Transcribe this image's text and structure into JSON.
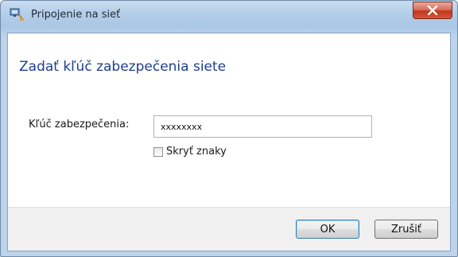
{
  "window": {
    "title": "Pripojenie na sieť",
    "close_glyph": "x"
  },
  "main": {
    "heading": "Zadať kľúč zabezpečenia siete",
    "key_label": "Kľúč zabezpečenia:",
    "key_value": "xxxxxxxx",
    "hide_chars_label": "Skryť znaky",
    "hide_chars_checked": false
  },
  "footer": {
    "ok_label": "OK",
    "cancel_label": "Zrušiť"
  },
  "icons": {
    "app": "network-icon",
    "close": "close-icon",
    "checkbox": "checkbox-icon"
  },
  "colors": {
    "heading": "#1e3f8f",
    "close_button": "#c2371f"
  }
}
